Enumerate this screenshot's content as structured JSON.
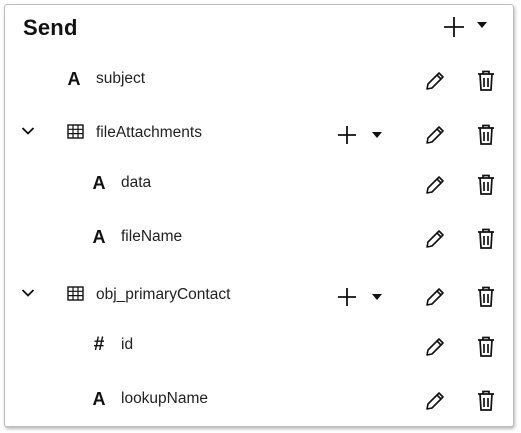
{
  "header": {
    "title": "Send"
  },
  "rows": [
    {
      "label": "subject",
      "type": "text"
    },
    {
      "label": "fileAttachments",
      "type": "table",
      "expanded": true
    },
    {
      "label": "data",
      "type": "text"
    },
    {
      "label": "fileName",
      "type": "text"
    },
    {
      "label": "obj_primaryContact",
      "type": "table",
      "expanded": true
    },
    {
      "label": "id",
      "type": "number"
    },
    {
      "label": "lookupName",
      "type": "text"
    }
  ],
  "icons": {
    "text_type_glyph": "A",
    "number_type_glyph": "#"
  },
  "colors": {
    "text": "#1f1f1f",
    "border": "#bdbdbd"
  }
}
